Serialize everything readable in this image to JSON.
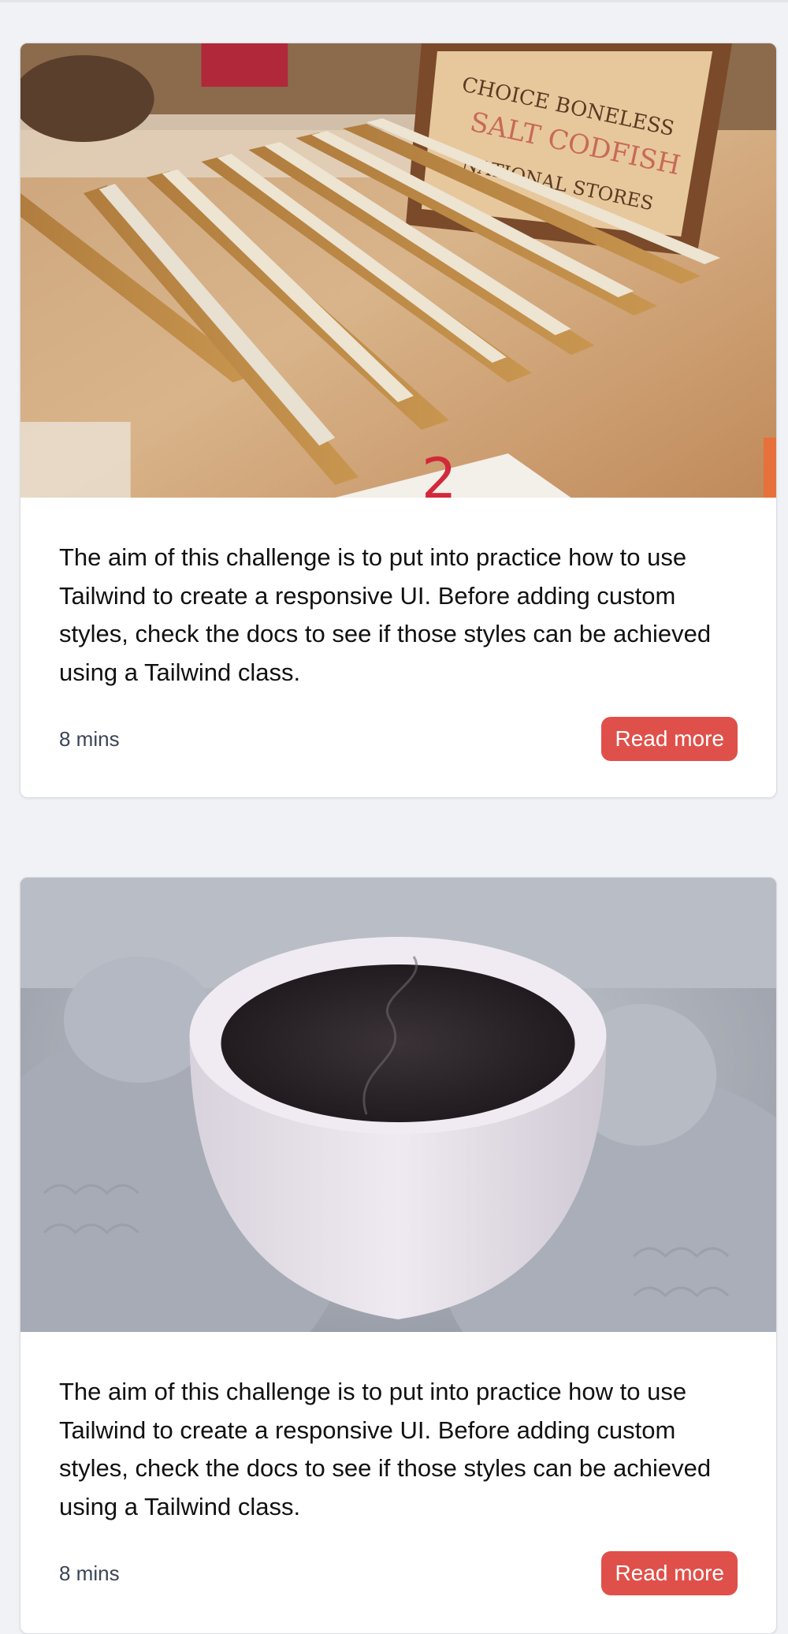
{
  "cards": [
    {
      "image": "rulers-photo",
      "text": "The aim of this challenge is to put into practice how to use Tailwind to create a responsive UI. Before adding custom styles, check the docs to see if those styles can be achieved using a Tailwind class.",
      "read_time": "8 mins",
      "button_label": "Read more"
    },
    {
      "image": "coffee-mittens-photo",
      "text": "The aim of this challenge is to put into practice how to use Tailwind to create a responsive UI. Before adding custom styles, check the docs to see if those styles can be achieved using a Tailwind class.",
      "read_time": "8 mins",
      "button_label": "Read more"
    }
  ],
  "colors": {
    "page_background": "#f0f2f5",
    "card_background": "#ffffff",
    "button_background": "#e0504a",
    "button_text": "#ffffff",
    "meta_text": "#3b4457"
  }
}
